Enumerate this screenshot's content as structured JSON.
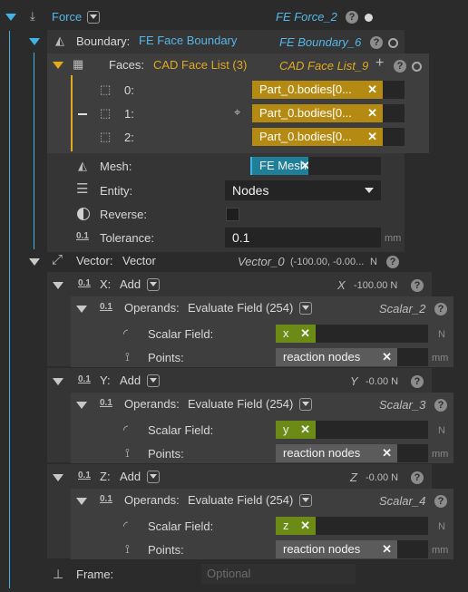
{
  "force": {
    "label": "Force",
    "name": "FE Force_2"
  },
  "boundary": {
    "label": "Boundary:",
    "value": "FE Face Boundary",
    "name": "FE Boundary_6"
  },
  "faces": {
    "label": "Faces:",
    "value": "CAD Face List (3)",
    "name": "CAD Face List_9",
    "items": [
      {
        "index": "0:",
        "value": "Part_0.bodies[0..."
      },
      {
        "index": "1:",
        "value": "Part_0.bodies[0..."
      },
      {
        "index": "2:",
        "value": "Part_0.bodies[0..."
      }
    ]
  },
  "mesh": {
    "label": "Mesh:",
    "value": "FE Mesh"
  },
  "entity": {
    "label": "Entity:",
    "value": "Nodes"
  },
  "reverse": {
    "label": "Reverse:"
  },
  "tolerance": {
    "label": "Tolerance:",
    "value": "0.1",
    "unit": "mm"
  },
  "vector": {
    "label": "Vector:",
    "value": "Vector",
    "name": "Vector_0",
    "summary": "(-100.00, -0.00...",
    "unit": "N"
  },
  "components": [
    {
      "axis": "X:",
      "op": "Add",
      "name": "X",
      "value": "-100.00 N",
      "operands_label": "Operands:",
      "operands_value": "Evaluate Field (254)",
      "scalar_name": "Scalar_2",
      "scalar_label": "Scalar Field:",
      "scalar_value": "x",
      "scalar_unit": "N",
      "points_label": "Points:",
      "points_value": "reaction nodes",
      "points_unit": "mm"
    },
    {
      "axis": "Y:",
      "op": "Add",
      "name": "Y",
      "value": "-0.00 N",
      "operands_label": "Operands:",
      "operands_value": "Evaluate Field (254)",
      "scalar_name": "Scalar_3",
      "scalar_label": "Scalar Field:",
      "scalar_value": "y",
      "scalar_unit": "N",
      "points_label": "Points:",
      "points_value": "reaction nodes",
      "points_unit": "mm"
    },
    {
      "axis": "Z:",
      "op": "Add",
      "name": "Z",
      "value": "-0.00 N",
      "operands_label": "Operands:",
      "operands_value": "Evaluate Field (254)",
      "scalar_name": "Scalar_4",
      "scalar_label": "Scalar Field:",
      "scalar_value": "z",
      "scalar_unit": "N",
      "points_label": "Points:",
      "points_value": "reaction nodes",
      "points_unit": "mm"
    }
  ],
  "frame": {
    "label": "Frame:",
    "placeholder": "Optional"
  },
  "icons": {
    "help": "?",
    "close": "✕",
    "add": "+"
  },
  "colors": {
    "accent_blue": "#3fb4e6",
    "accent_gold": "#e3a91f",
    "chip_teal": "#1f7f98",
    "chip_green": "#6c8a16"
  }
}
